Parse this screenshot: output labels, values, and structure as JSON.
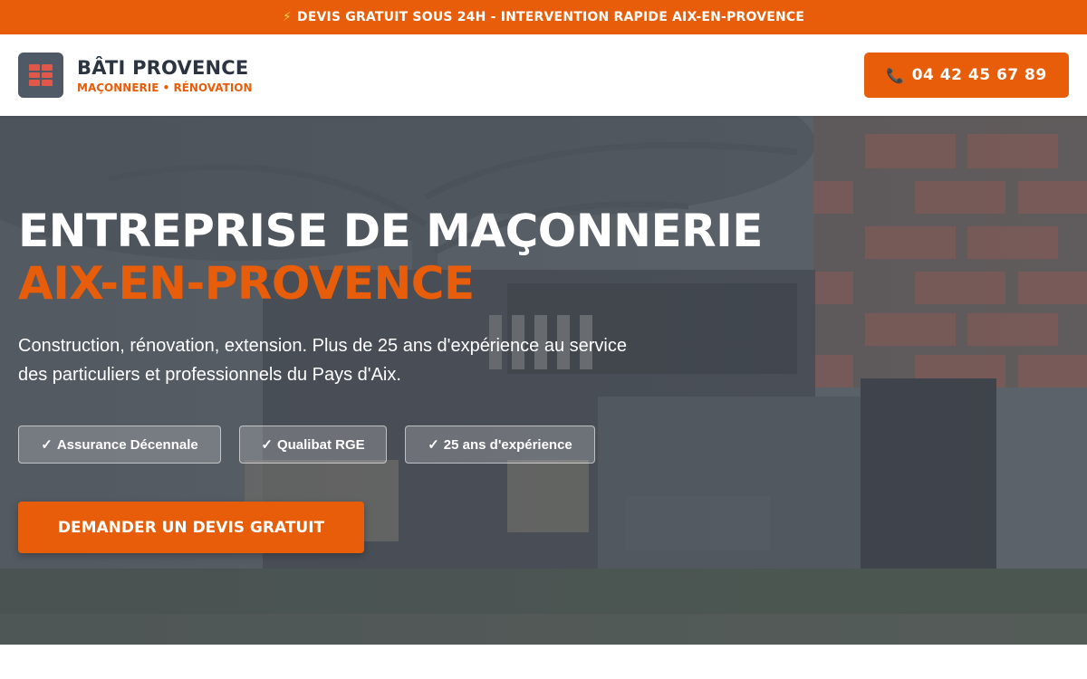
{
  "topbar": {
    "icon": "lightning-icon",
    "text": "DEVIS GRATUIT SOUS 24H - INTERVENTION RAPIDE AIX-EN-PROVENCE"
  },
  "header": {
    "logo_icon": "brick-icon",
    "brand_name": "BÂTI PROVENCE",
    "brand_tagline": "MAÇONNERIE • RÉNOVATION",
    "phone_icon": "phone-icon",
    "phone": "04 42 45 67 89"
  },
  "hero": {
    "title_line1": "ENTREPRISE DE MAÇONNERIE",
    "title_line2": "AIX-EN-PROVENCE",
    "description": "Construction, rénovation, extension. Plus de 25 ans d'expérience au service des particuliers et professionnels du Pays d'Aix.",
    "badges": [
      {
        "check": "✓",
        "label": "Assurance Décennale"
      },
      {
        "check": "✓",
        "label": "Qualibat RGE"
      },
      {
        "check": "✓",
        "label": "25 ans d'expérience"
      }
    ],
    "cta_label": "DEMANDER UN DEVIS GRATUIT"
  },
  "colors": {
    "accent": "#e85d0a",
    "dark_text": "#2b3440",
    "hero_overlay": "#5e646c"
  }
}
